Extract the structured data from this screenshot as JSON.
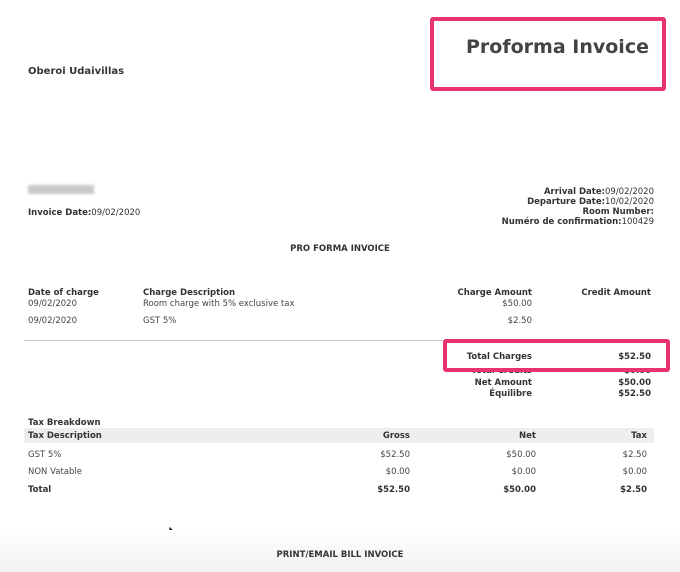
{
  "header": {
    "title": "Proforma Invoice",
    "hotel_name": "Oberoi Udaivillas",
    "invoice_date_label": "Invoice Date:",
    "invoice_date_value": "09/02/2020"
  },
  "stay": {
    "arrival_label": "Arrival Date:",
    "arrival_value": "09/02/2020",
    "departure_label": "Departure Date:",
    "departure_value": "10/02/2020",
    "room_label": "Room Number:",
    "room_value": "",
    "confirmation_label": "Numéro de confirmation:",
    "confirmation_value": "100429"
  },
  "section_title": "PRO FORMA INVOICE",
  "charges": {
    "headers": [
      "Date of charge",
      "Charge Description",
      "Charge Amount",
      "Credit Amount"
    ],
    "rows": [
      {
        "date": "09/02/2020",
        "description": "Room charge with 5% exclusive tax",
        "amount": "$50.00",
        "credit": ""
      },
      {
        "date": "09/02/2020",
        "description": "GST 5%",
        "amount": "$2.50",
        "credit": ""
      }
    ]
  },
  "totals": [
    {
      "label": "Total Charges",
      "value": "$52.50"
    },
    {
      "label": "Total Credits",
      "value": "$0.00"
    },
    {
      "label": "Net Amount",
      "value": "$50.00"
    },
    {
      "label": "Équilibre",
      "value": "$52.50"
    }
  ],
  "tax": {
    "title": "Tax Breakdown",
    "headers": [
      "Tax Description",
      "Gross",
      "Net",
      "Tax"
    ],
    "rows": [
      {
        "desc": "GST 5%",
        "gross": "$52.50",
        "net": "$50.00",
        "tax": "$2.50"
      },
      {
        "desc": "NON Vatable",
        "gross": "$0.00",
        "net": "$0.00",
        "tax": "$0.00"
      },
      {
        "desc": "Total",
        "gross": "$52.50",
        "net": "$50.00",
        "tax": "$2.50"
      }
    ]
  },
  "footer": {
    "print_label": "PRINT/EMAIL BILL INVOICE"
  },
  "colors": {
    "highlight": "#e8336d"
  },
  "icons": {
    "cursor": "mouse-pointer-icon"
  }
}
